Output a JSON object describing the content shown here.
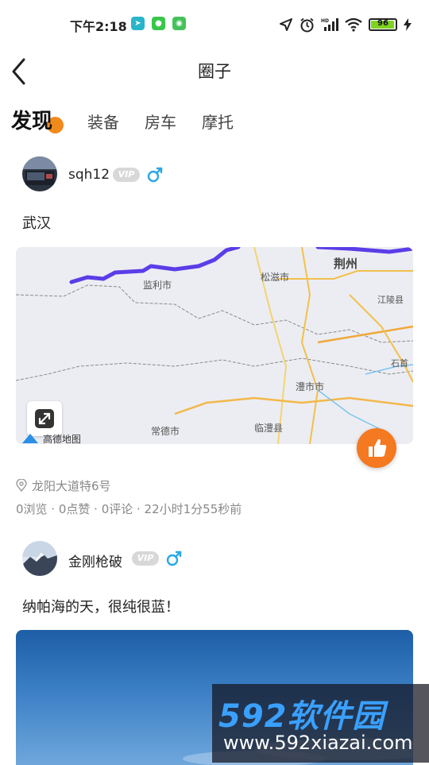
{
  "status_bar": {
    "time": "下午2:18",
    "battery": {
      "level": 96,
      "label": "96"
    },
    "icons": [
      "telegram-icon",
      "wechat-icon",
      "android-icon",
      "location-arrow-icon",
      "alarm-icon",
      "hd-signal-icon",
      "wifi-icon",
      "battery-icon",
      "charging-icon"
    ]
  },
  "header": {
    "title": "圈子"
  },
  "tabs": [
    {
      "label": "发现",
      "active": true
    },
    {
      "label": "装备",
      "active": false
    },
    {
      "label": "房车",
      "active": false
    },
    {
      "label": "摩托",
      "active": false
    }
  ],
  "posts": [
    {
      "username": "sqh12",
      "vip": "VIP",
      "gender": "male",
      "text": "武汉",
      "map": {
        "labels": [
          "监利市",
          "荆州",
          "松滋市",
          "江陵县",
          "石首",
          "澧市市",
          "临澧县",
          "常德市",
          "津市"
        ],
        "logo": "高德地图"
      },
      "location": "龙阳大道特6号",
      "stats": "0浏览 · 0点赞 · 0评论 · 22小时1分55秒前"
    },
    {
      "username": "金刚枪破",
      "vip": "VIP",
      "gender": "male",
      "text": "纳帕海的天，很纯很蓝！"
    }
  ],
  "watermark": {
    "title": "592软件园",
    "url": "www.592xiazai.com"
  },
  "colors": {
    "accent": "#f08a1d",
    "like": "#f47920",
    "gender": "#2aa8e6",
    "route": "#5b3de8"
  }
}
